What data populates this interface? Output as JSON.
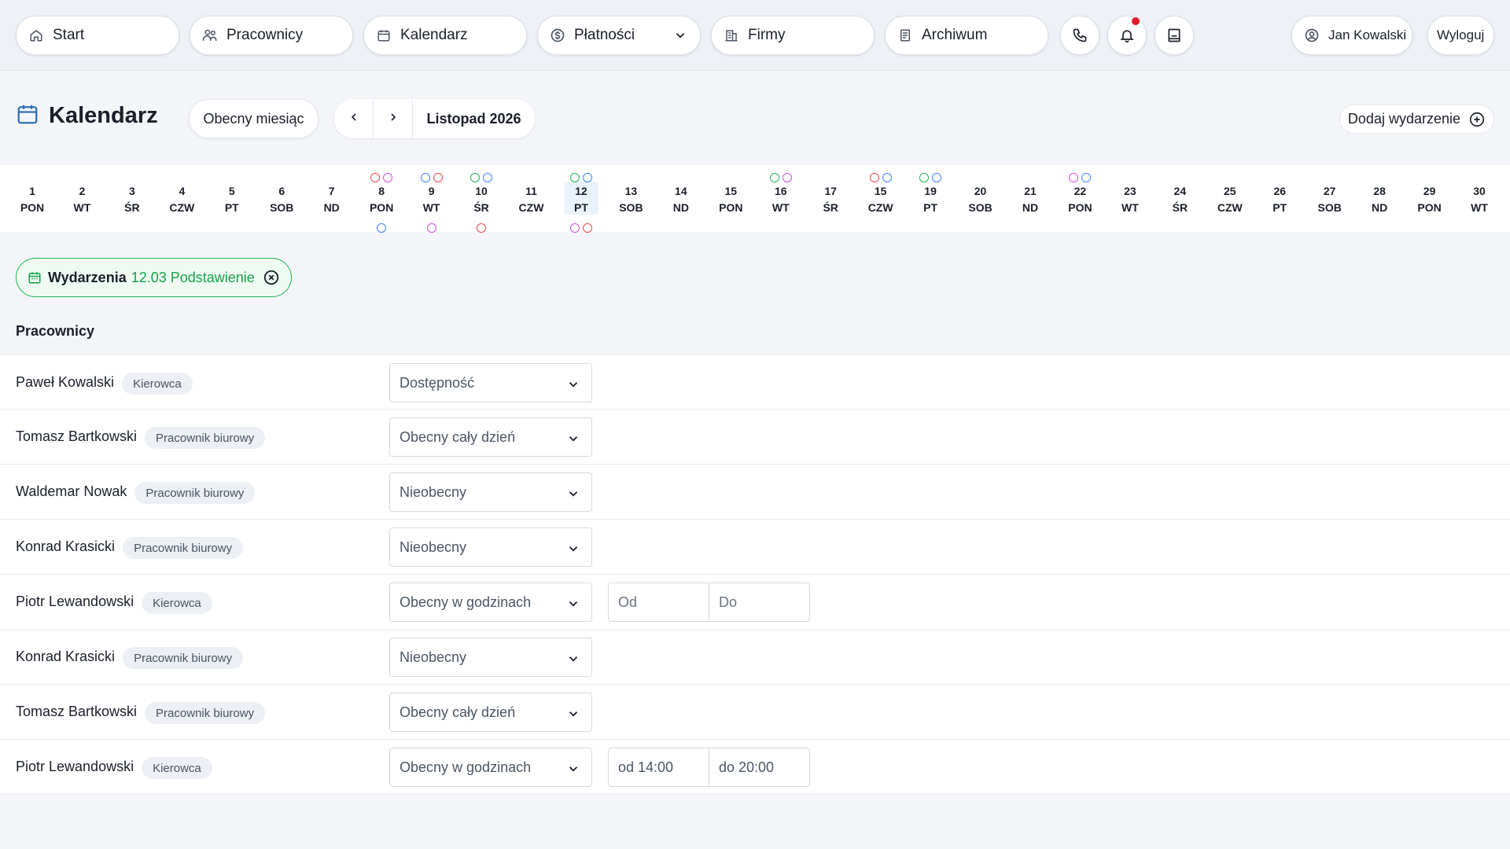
{
  "nav": {
    "items": [
      {
        "label": "Start",
        "icon": "home-icon"
      },
      {
        "label": "Pracownicy",
        "icon": "people-icon"
      },
      {
        "label": "Kalendarz",
        "icon": "calendar-icon"
      },
      {
        "label": "Płatności",
        "icon": "dollar-icon"
      },
      {
        "label": "Firmy",
        "icon": "building-icon"
      },
      {
        "label": "Archiwum",
        "icon": "archive-icon"
      }
    ],
    "user_name": "Jan Kowalski",
    "logout_label": "Wyloguj",
    "has_notification": true
  },
  "header": {
    "title": "Kalendarz",
    "current_month_button": "Obecny miesiąc",
    "month_label": "Listopad 2026",
    "add_event_label": "Dodaj wydarzenie"
  },
  "days": [
    {
      "num": "1",
      "wd": "PON",
      "top": [],
      "bottom": []
    },
    {
      "num": "2",
      "wd": "WT",
      "top": [],
      "bottom": []
    },
    {
      "num": "3",
      "wd": "ŚR",
      "top": [],
      "bottom": []
    },
    {
      "num": "4",
      "wd": "CZW",
      "top": [],
      "bottom": []
    },
    {
      "num": "5",
      "wd": "PT",
      "top": [],
      "bottom": []
    },
    {
      "num": "6",
      "wd": "SOB",
      "top": [],
      "bottom": []
    },
    {
      "num": "7",
      "wd": "ND",
      "top": [],
      "bottom": []
    },
    {
      "num": "8",
      "wd": "PON",
      "top": [
        "red",
        "purple"
      ],
      "bottom": [
        "blue"
      ]
    },
    {
      "num": "9",
      "wd": "WT",
      "top": [
        "blue",
        "red"
      ],
      "bottom": [
        "purple"
      ]
    },
    {
      "num": "10",
      "wd": "ŚR",
      "top": [
        "green",
        "blue"
      ],
      "bottom": [
        "red"
      ]
    },
    {
      "num": "11",
      "wd": "CZW",
      "top": [],
      "bottom": []
    },
    {
      "num": "12",
      "wd": "PT",
      "top": [
        "green",
        "blue"
      ],
      "bottom": [
        "purple",
        "red"
      ],
      "selected": true
    },
    {
      "num": "13",
      "wd": "SOB",
      "top": [],
      "bottom": []
    },
    {
      "num": "14",
      "wd": "ND",
      "top": [],
      "bottom": []
    },
    {
      "num": "15",
      "wd": "PON",
      "top": [],
      "bottom": []
    },
    {
      "num": "16",
      "wd": "WT",
      "top": [
        "green",
        "purple"
      ],
      "bottom": []
    },
    {
      "num": "17",
      "wd": "ŚR",
      "top": [],
      "bottom": []
    },
    {
      "num": "15",
      "wd": "CZW",
      "top": [
        "red",
        "blue"
      ],
      "bottom": []
    },
    {
      "num": "19",
      "wd": "PT",
      "top": [
        "green",
        "blue"
      ],
      "bottom": []
    },
    {
      "num": "20",
      "wd": "SOB",
      "top": [],
      "bottom": []
    },
    {
      "num": "21",
      "wd": "ND",
      "top": [],
      "bottom": []
    },
    {
      "num": "22",
      "wd": "PON",
      "top": [
        "purple",
        "blue"
      ],
      "bottom": []
    },
    {
      "num": "23",
      "wd": "WT",
      "top": [],
      "bottom": []
    },
    {
      "num": "24",
      "wd": "ŚR",
      "top": [],
      "bottom": []
    },
    {
      "num": "25",
      "wd": "CZW",
      "top": [],
      "bottom": []
    },
    {
      "num": "26",
      "wd": "PT",
      "top": [],
      "bottom": []
    },
    {
      "num": "27",
      "wd": "SOB",
      "top": [],
      "bottom": []
    },
    {
      "num": "28",
      "wd": "ND",
      "top": [],
      "bottom": []
    },
    {
      "num": "29",
      "wd": "PON",
      "top": [],
      "bottom": []
    },
    {
      "num": "30",
      "wd": "WT",
      "top": [],
      "bottom": []
    }
  ],
  "dot_colors": {
    "red": "#e5484d",
    "purple": "#d04fd6",
    "blue": "#3b82f6",
    "green": "#22b455"
  },
  "filter": {
    "label": "Wydarzenia",
    "value": "12.03 Podstawienie"
  },
  "section_title": "Pracownicy",
  "employees": [
    {
      "name": "Paweł Kowalski",
      "role": "Kierowca",
      "status": "Dostępność"
    },
    {
      "name": "Tomasz Bartkowski",
      "role": "Pracownik biurowy",
      "status": "Obecny cały dzień"
    },
    {
      "name": "Waldemar Nowak",
      "role": "Pracownik biurowy",
      "status": "Nieobecny"
    },
    {
      "name": "Konrad Krasicki",
      "role": "Pracownik biurowy",
      "status": "Nieobecny"
    },
    {
      "name": "Piotr Lewandowski",
      "role": "Kierowca",
      "status": "Obecny w godzinach",
      "from": "Od",
      "to": "Do",
      "time_filled": false
    },
    {
      "name": "Konrad Krasicki",
      "role": "Pracownik biurowy",
      "status": "Nieobecny"
    },
    {
      "name": "Tomasz Bartkowski",
      "role": "Pracownik biurowy",
      "status": "Obecny cały dzień"
    },
    {
      "name": "Piotr Lewandowski",
      "role": "Kierowca",
      "status": "Obecny w godzinach",
      "from": "od 14:00",
      "to": "do 20:00",
      "time_filled": true
    }
  ]
}
